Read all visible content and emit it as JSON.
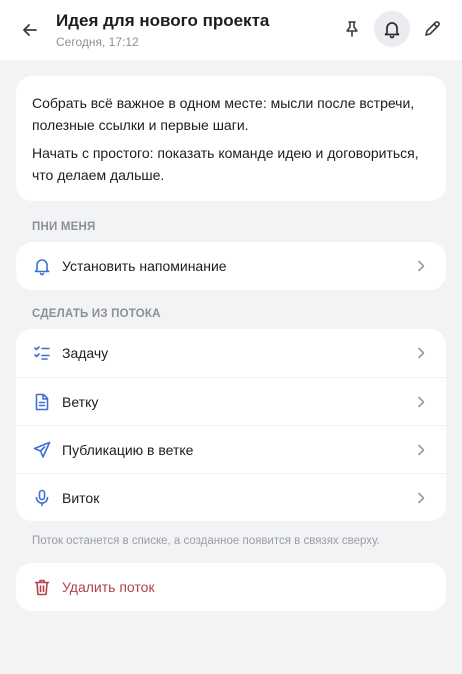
{
  "header": {
    "title": "Идея для нового проекта",
    "subtitle": "Сегодня, 17:12",
    "back_icon": "arrow-left-icon",
    "pin_icon": "pin-icon",
    "bell_icon": "bell-icon",
    "edit_icon": "pencil-icon"
  },
  "note": {
    "paragraphs": [
      "Собрать всё важное в одном месте: мысли после встречи, полезные ссылки и первые шаги.",
      "Начать с простого: показать команде идею и договориться, что делаем дальше."
    ]
  },
  "reminder_section": {
    "label": "ПНИ МЕНЯ",
    "items": [
      {
        "label": "Установить напоминание",
        "icon": "bell-icon"
      }
    ]
  },
  "convert_section": {
    "label": "СДЕЛАТЬ ИЗ ПОТОКА",
    "items": [
      {
        "label": "Задачу",
        "icon": "checklist-icon"
      },
      {
        "label": "Ветку",
        "icon": "document-icon"
      },
      {
        "label": "Публикацию в ветке",
        "icon": "send-icon"
      },
      {
        "label": "Виток",
        "icon": "microphone-icon"
      }
    ]
  },
  "footnote": "Поток останется в списке, а созданное появится в связях сверху.",
  "delete": {
    "label": "Удалить поток",
    "icon": "trash-icon"
  },
  "colors": {
    "accent": "#3f6fd1",
    "danger": "#b3404a",
    "background": "#f2f3f5",
    "card": "#ffffff",
    "muted": "#8c8f94"
  }
}
